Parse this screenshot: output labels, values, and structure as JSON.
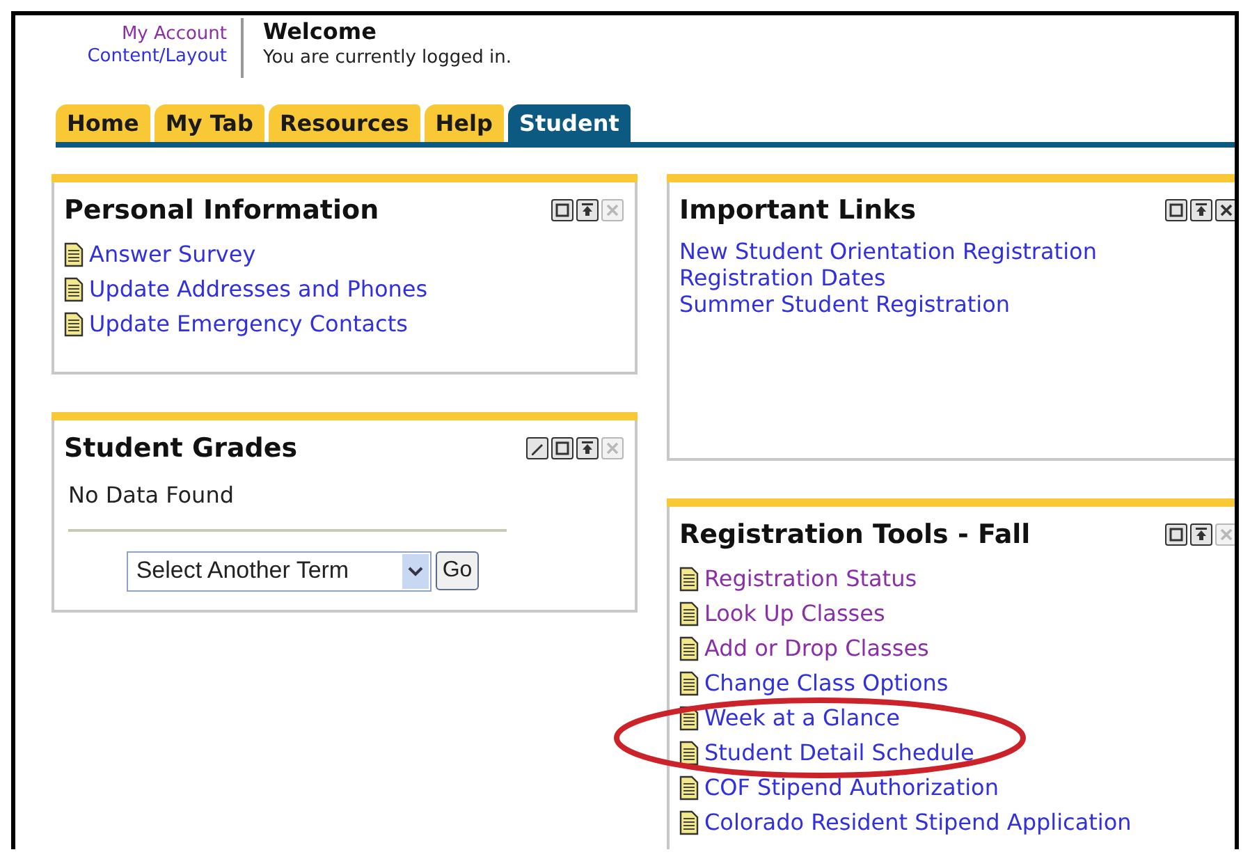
{
  "header": {
    "links": [
      {
        "label": "My Account",
        "visited": true
      },
      {
        "label": "Content/Layout",
        "visited": false
      }
    ],
    "title": "Welcome",
    "subtitle": "You are currently logged in."
  },
  "tabs": [
    {
      "label": "Home",
      "selected": false
    },
    {
      "label": "My Tab",
      "selected": false
    },
    {
      "label": "Resources",
      "selected": false
    },
    {
      "label": "Help",
      "selected": false
    },
    {
      "label": "Student",
      "selected": true
    }
  ],
  "columns": [
    {
      "panels": [
        {
          "title": "Personal Information",
          "controls": [
            {
              "kind": "maximize",
              "disabled": false
            },
            {
              "kind": "minimize",
              "disabled": false
            },
            {
              "kind": "close",
              "disabled": true
            }
          ],
          "body": [
            {
              "kind": "doc_link",
              "label": "Answer Survey",
              "visited": false
            },
            {
              "kind": "doc_link",
              "label": "Update Addresses and Phones",
              "visited": false
            },
            {
              "kind": "doc_link",
              "label": "Update Emergency Contacts",
              "visited": false
            }
          ]
        },
        {
          "title": "Student Grades",
          "controls": [
            {
              "kind": "edit",
              "disabled": false
            },
            {
              "kind": "maximize",
              "disabled": false
            },
            {
              "kind": "minimize",
              "disabled": false
            },
            {
              "kind": "close",
              "disabled": true
            }
          ],
          "body": [
            {
              "kind": "message",
              "label": "No Data Found"
            },
            {
              "kind": "rule"
            },
            {
              "kind": "term_select",
              "value": "Select Another Term",
              "button": "Go"
            }
          ]
        }
      ]
    },
    {
      "panels": [
        {
          "title": "Important Links",
          "controls": [
            {
              "kind": "maximize",
              "disabled": false
            },
            {
              "kind": "minimize",
              "disabled": false
            },
            {
              "kind": "close",
              "disabled": false
            }
          ],
          "body": [
            {
              "kind": "link",
              "label": "New Student Orientation Registration",
              "visited": false
            },
            {
              "kind": "link",
              "label": "Registration Dates",
              "visited": false
            },
            {
              "kind": "link",
              "label": "Summer Student Registration",
              "visited": false
            }
          ]
        },
        {
          "title": "Registration Tools - Fall",
          "controls": [
            {
              "kind": "maximize",
              "disabled": false
            },
            {
              "kind": "minimize",
              "disabled": false
            },
            {
              "kind": "close",
              "disabled": true
            }
          ],
          "body": [
            {
              "kind": "doc_link",
              "label": "Registration Status",
              "visited": true
            },
            {
              "kind": "doc_link",
              "label": "Look Up Classes",
              "visited": true
            },
            {
              "kind": "doc_link",
              "label": "Add or Drop Classes",
              "visited": true
            },
            {
              "kind": "doc_link",
              "label": "Change Class Options",
              "visited": false
            },
            {
              "kind": "doc_link",
              "label": "Week at a Glance",
              "visited": false
            },
            {
              "kind": "doc_link",
              "label": "Student Detail Schedule",
              "visited": false
            },
            {
              "kind": "doc_link",
              "label": "COF Stipend Authorization",
              "visited": false
            },
            {
              "kind": "doc_link",
              "label": "Colorado Resident Stipend Application",
              "visited": false
            }
          ]
        }
      ]
    }
  ]
}
